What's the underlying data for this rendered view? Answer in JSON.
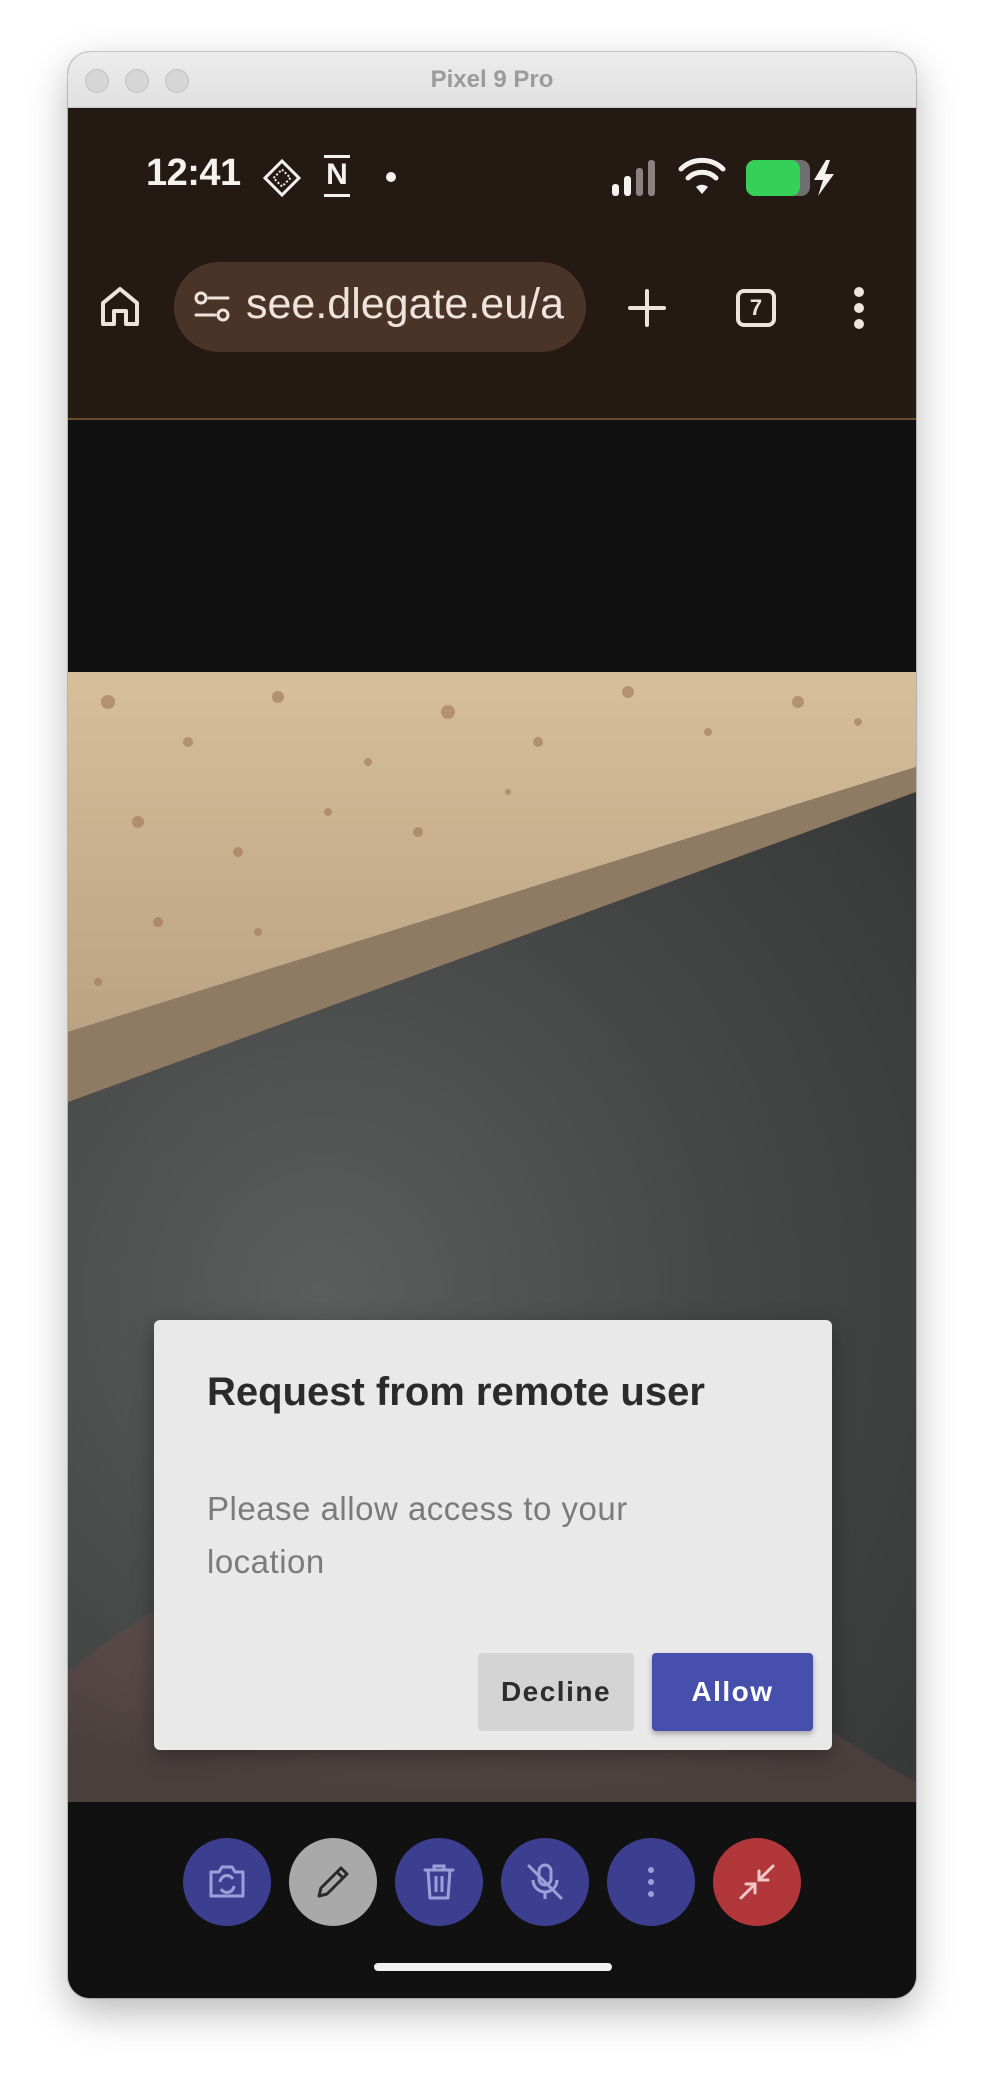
{
  "window": {
    "title": "Pixel 9 Pro"
  },
  "status_bar": {
    "time": "12:41",
    "notification_letter": "N"
  },
  "browser": {
    "url": "see.dlegate.eu/a",
    "tab_count": "7"
  },
  "dialog": {
    "title": "Request from remote user",
    "body": "Please allow access to your location",
    "decline_label": "Decline",
    "allow_label": "Allow"
  },
  "toolbar": {
    "buttons": [
      {
        "icon": "flip-camera-icon",
        "color": "#3c3f8f"
      },
      {
        "icon": "pencil-icon",
        "color": "#a9a9a9"
      },
      {
        "icon": "trash-icon",
        "color": "#3c3f8f"
      },
      {
        "icon": "mic-off-icon",
        "color": "#3c3f8f"
      },
      {
        "icon": "more-vertical-icon",
        "color": "#3c3f8f"
      },
      {
        "icon": "minimize-icon",
        "color": "#b2373a"
      }
    ]
  },
  "colors": {
    "accent": "#464fab",
    "browser_bar": "#241913",
    "battery": "#35d05a"
  }
}
